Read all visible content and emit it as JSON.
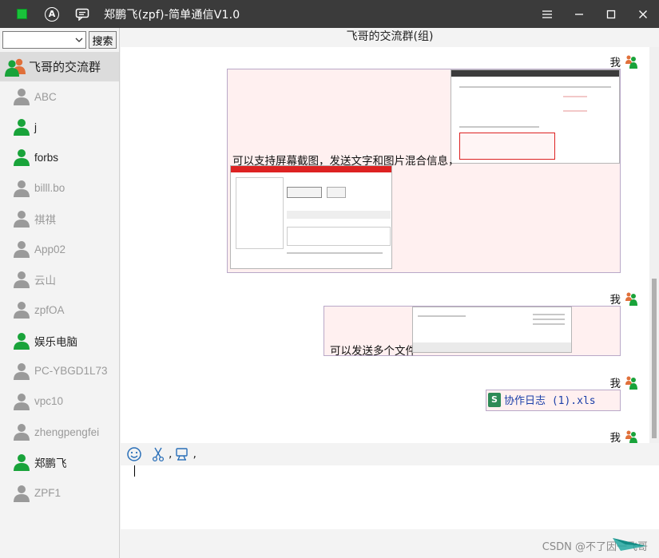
{
  "window": {
    "title": "郑鹏飞(zpf)-简单通信V1.0",
    "icons": [
      "app-icon",
      "circle-a-icon",
      "chat-bubble-icon"
    ],
    "controls": [
      "menu-icon",
      "minimize-icon",
      "maximize-icon",
      "close-icon"
    ]
  },
  "sidebar": {
    "search": {
      "value": "",
      "button_label": "搜索"
    },
    "group": {
      "name": "飞哥的交流群",
      "icon": "group-icon"
    },
    "contacts": [
      {
        "name": "ABC",
        "status": "offline"
      },
      {
        "name": "j",
        "status": "online"
      },
      {
        "name": "forbs",
        "status": "online"
      },
      {
        "name": "billl.bo",
        "status": "offline"
      },
      {
        "name": "祺祺",
        "status": "offline"
      },
      {
        "name": "App02",
        "status": "offline"
      },
      {
        "name": "云山",
        "status": "offline"
      },
      {
        "name": "zpfOA",
        "status": "offline"
      },
      {
        "name": "娱乐电脑",
        "status": "online"
      },
      {
        "name": "PC-YBGD1L73",
        "status": "offline"
      },
      {
        "name": "vpc10",
        "status": "offline"
      },
      {
        "name": "zhengpengfei",
        "status": "offline"
      },
      {
        "name": "郑鹏飞",
        "status": "online"
      },
      {
        "name": "ZPF1",
        "status": "offline"
      }
    ]
  },
  "chat": {
    "title": "飞哥的交流群(组)",
    "messages": [
      {
        "sender": "我",
        "text": "可以支持屏幕截图，发送文字和图片混合信息，"
      },
      {
        "sender": "我",
        "text": "可以发送多个文件"
      },
      {
        "sender": "我",
        "file": "协作日志 (1).xls"
      },
      {
        "sender": "我"
      }
    ]
  },
  "composer": {
    "tools": [
      "emoji-icon",
      "scissors-icon",
      "screen-icon"
    ],
    "separators": [
      ",",
      ","
    ],
    "input_value": "",
    "send_icon": "send-icon"
  },
  "watermark": "CSDN @不了因一飞哥",
  "colors": {
    "titlebar": "#3b3b3b",
    "online": "#19a33a",
    "offline": "#9a9a9a",
    "bubble": "#fff0f0",
    "file_link": "#1a3ea8"
  }
}
